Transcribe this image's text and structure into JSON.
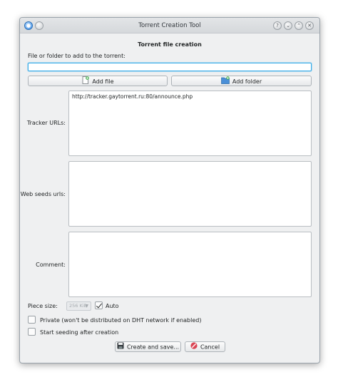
{
  "window": {
    "title": "Torrent Creation Tool"
  },
  "titlebar_buttons": {
    "help": "?",
    "minimize": "⌄",
    "maximize": "⌃",
    "close": "✕"
  },
  "form": {
    "heading": "Torrent file creation",
    "path_label": "File or folder to add to the torrent:",
    "path_value": "",
    "add_file_label": "Add file",
    "add_folder_label": "Add folder",
    "trackers_label": "Tracker URLs:",
    "trackers_value": "http://tracker.gaytorrent.ru:80/announce.php",
    "webseeds_label": "Web seeds urls:",
    "webseeds_value": "",
    "comment_label": "Comment:",
    "comment_value": "",
    "piece_size_label": "Piece size:",
    "piece_size_value": "256 KiB",
    "auto_label": "Auto",
    "auto_checked": true,
    "private_label": "Private (won't be distributed on DHT network if enabled)",
    "private_checked": false,
    "seed_label": "Start seeding after creation",
    "seed_checked": false,
    "create_label": "Create and save...",
    "cancel_label": "Cancel"
  },
  "icons": {
    "add_file": "document-new-icon",
    "add_folder": "folder-new-icon",
    "create": "save-icon",
    "cancel": "cancel-icon"
  },
  "colors": {
    "accent": "#3daee9",
    "window_bg": "#eff0f1",
    "cancel_red": "#da4453"
  }
}
